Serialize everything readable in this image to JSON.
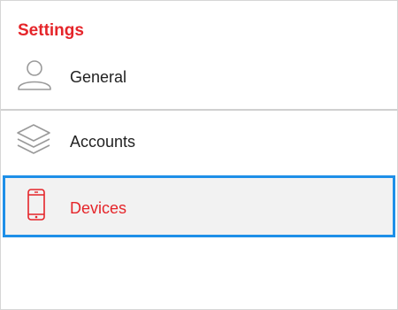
{
  "panel": {
    "title": "Settings"
  },
  "menu": {
    "items": [
      {
        "label": "General",
        "icon": "user-icon"
      },
      {
        "label": "Accounts",
        "icon": "layers-icon"
      },
      {
        "label": "Devices",
        "icon": "smartphone-icon",
        "selected": true
      }
    ]
  },
  "colors": {
    "accent": "#e5252a",
    "selection_border": "#1e8fe8",
    "selected_background": "#f2f2f2",
    "icon_gray": "#9a9a9a"
  }
}
